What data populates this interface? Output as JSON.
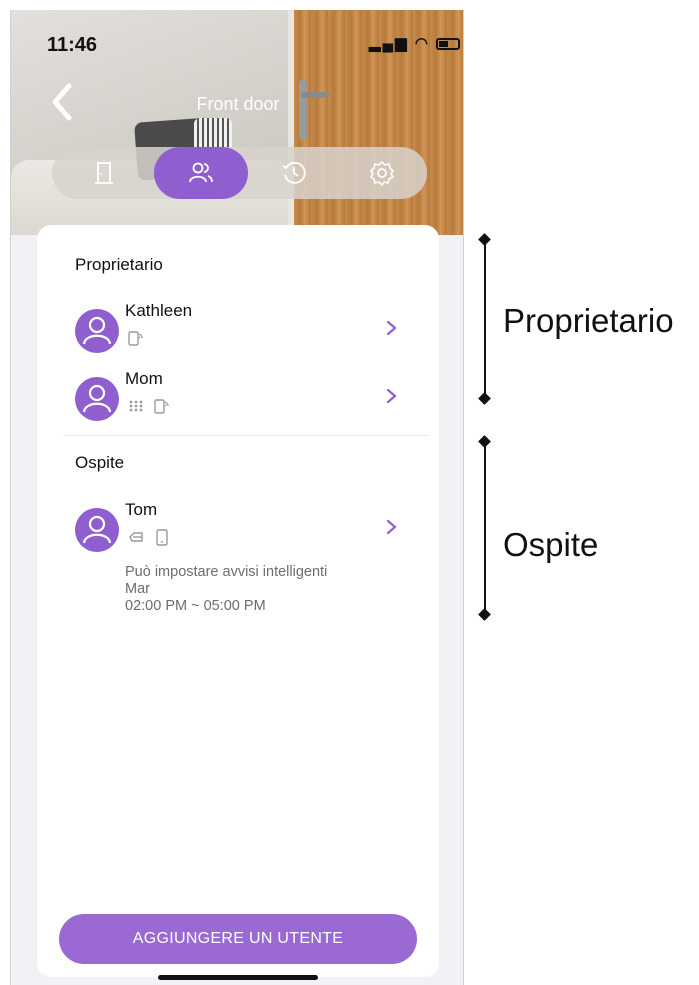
{
  "status_bar": {
    "time": "11:46",
    "signal_icons": "ıl ✦"
  },
  "header": {
    "title": "Front door"
  },
  "tabs": [
    {
      "name": "door",
      "active": false
    },
    {
      "name": "users",
      "active": true
    },
    {
      "name": "history",
      "active": false
    },
    {
      "name": "settings",
      "active": false
    }
  ],
  "sections": {
    "owner": {
      "title": "Proprietario",
      "users": [
        {
          "name": "Kathleen",
          "credentials": [
            "phone-nfc"
          ]
        },
        {
          "name": "Mom",
          "credentials": [
            "keypad",
            "phone-nfc"
          ]
        }
      ]
    },
    "guest": {
      "title": "Ospite",
      "users": [
        {
          "name": "Tom",
          "credentials": [
            "card",
            "phone"
          ],
          "note": "Può impostare avvisi intelligenti",
          "day": "Mar",
          "time_range": "02:00 PM ~ 05:00 PM"
        }
      ]
    }
  },
  "add_button": {
    "label": "AGGIUNGERE UN UTENTE"
  },
  "annotations": {
    "owner_label": "Proprietario",
    "guest_label": "Ospite"
  },
  "colors": {
    "accent": "#8f5fcf",
    "button": "#9a69d4",
    "background": "#f2f2f6"
  }
}
